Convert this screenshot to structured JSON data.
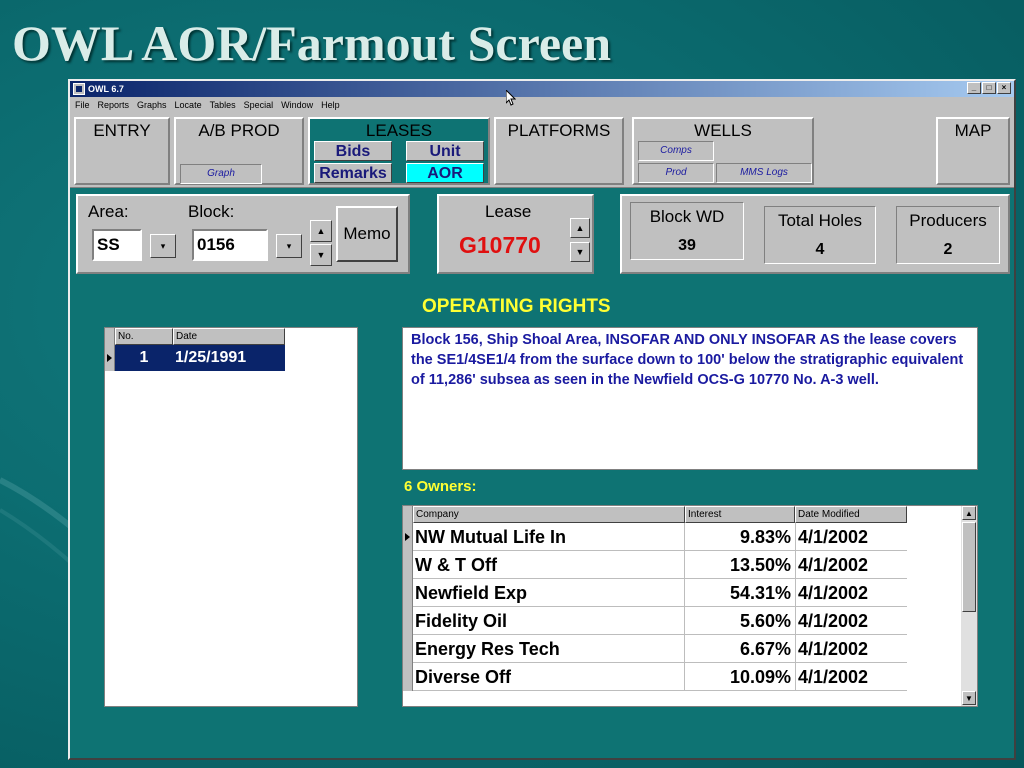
{
  "slide": {
    "title": "OWL AOR/Farmout Screen"
  },
  "window": {
    "title": "OWL 6.7",
    "controls": [
      "_",
      "□",
      "×"
    ],
    "menu": [
      "File",
      "Reports",
      "Graphs",
      "Locate",
      "Tables",
      "Special",
      "Window",
      "Help"
    ]
  },
  "modules": {
    "entry": "ENTRY",
    "ab_prod": "A/B PROD",
    "ab_graph": "Graph",
    "leases": "LEASES",
    "bids": "Bids",
    "unit": "Unit",
    "remarks": "Remarks",
    "aor": "AOR",
    "platforms": "PLATFORMS",
    "wells": "WELLS",
    "comps": "Comps",
    "prod": "Prod",
    "mms_logs": "MMS Logs",
    "map": "MAP"
  },
  "selector": {
    "area_label": "Area:",
    "area_value": "SS",
    "block_label": "Block:",
    "block_value": "0156",
    "memo_label": "Memo",
    "up_arrow": "▲",
    "down_arrow": "▼",
    "drop_arrow": "▾"
  },
  "lease": {
    "label": "Lease",
    "value": "G10770"
  },
  "stats": {
    "block_wd": {
      "label": "Block WD",
      "value": "39"
    },
    "total_holes": {
      "label": "Total Holes",
      "value": "4"
    },
    "producers": {
      "label": "Producers",
      "value": "2"
    }
  },
  "operating_rights": {
    "title": "OPERATING RIGHTS",
    "columns": [
      "No.",
      "Date"
    ],
    "rows": [
      {
        "no": "1",
        "date": "1/25/1991"
      }
    ],
    "description": "Block 156, Ship Shoal Area, INSOFAR AND ONLY INSOFAR AS the lease covers the SE1/4SE1/4 from the surface down to 100' below the stratigraphic equivalent of 11,286' subsea as seen in the Newfield OCS-G 10770 No. A-3 well."
  },
  "owners": {
    "label": "6 Owners:",
    "columns": [
      "Company",
      "Interest",
      "Date Modified"
    ],
    "rows": [
      {
        "company": "NW Mutual Life In",
        "interest": "9.83%",
        "date": "4/1/2002"
      },
      {
        "company": "W & T Off",
        "interest": "13.50%",
        "date": "4/1/2002"
      },
      {
        "company": "Newfield Exp",
        "interest": "54.31%",
        "date": "4/1/2002"
      },
      {
        "company": "Fidelity Oil",
        "interest": "5.60%",
        "date": "4/1/2002"
      },
      {
        "company": "Energy Res Tech",
        "interest": "6.67%",
        "date": "4/1/2002"
      },
      {
        "company": "Diverse Off",
        "interest": "10.09%",
        "date": "4/1/2002"
      }
    ]
  },
  "colors": {
    "background": "#0b6a6e",
    "panel": "#c0c0c0",
    "active_tab": "#0e7373",
    "selected_button": "#00ffff",
    "lease_value": "#e01010",
    "heading": "#ffff33",
    "selected_row": "#0a246a"
  }
}
